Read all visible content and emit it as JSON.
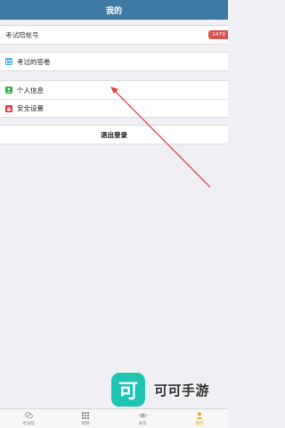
{
  "header": {
    "title": "我的"
  },
  "account": {
    "label": "考试陪帐号",
    "badge": "1479"
  },
  "menu": {
    "answers_label": "考过的答卷",
    "profile_label": "个人信息",
    "security_label": "安全设置"
  },
  "logout_label": "退出登录",
  "watermark": {
    "logo_char": "可",
    "text": "可可手游"
  },
  "tabs": [
    {
      "label": "考试陪",
      "icon": "chat-bubbles-icon"
    },
    {
      "label": "视频",
      "icon": "grid-icon"
    },
    {
      "label": "发现",
      "icon": "eye-icon"
    },
    {
      "label": "我的",
      "icon": "user-icon",
      "active": true
    }
  ],
  "colors": {
    "header": "#3e7aa3",
    "badge": "#d9534f",
    "active_tab": "#f0a22b",
    "arrow": "#e0474c",
    "logo": "#1fc5b2"
  }
}
